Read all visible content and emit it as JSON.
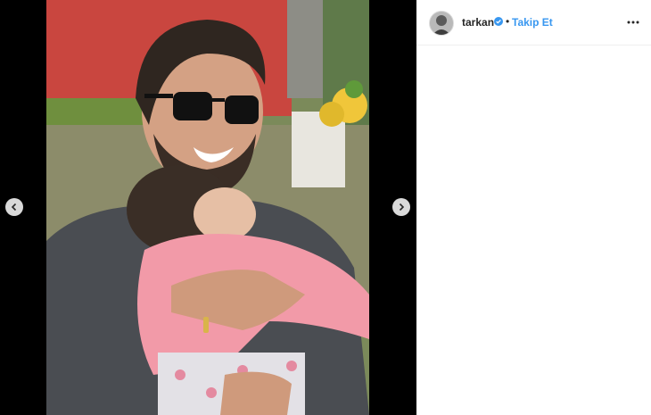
{
  "post": {
    "username": "tarkan",
    "separator": "•",
    "follow_label": "Takip Et",
    "verified": true
  },
  "colors": {
    "accent": "#3897f0",
    "media_background": "#000000",
    "verified_badge": "#3897f0"
  },
  "icons": {
    "prev": "chevron-left-icon",
    "next": "chevron-right-icon",
    "more": "more-horizontal-icon",
    "verified": "verified-badge-icon"
  }
}
